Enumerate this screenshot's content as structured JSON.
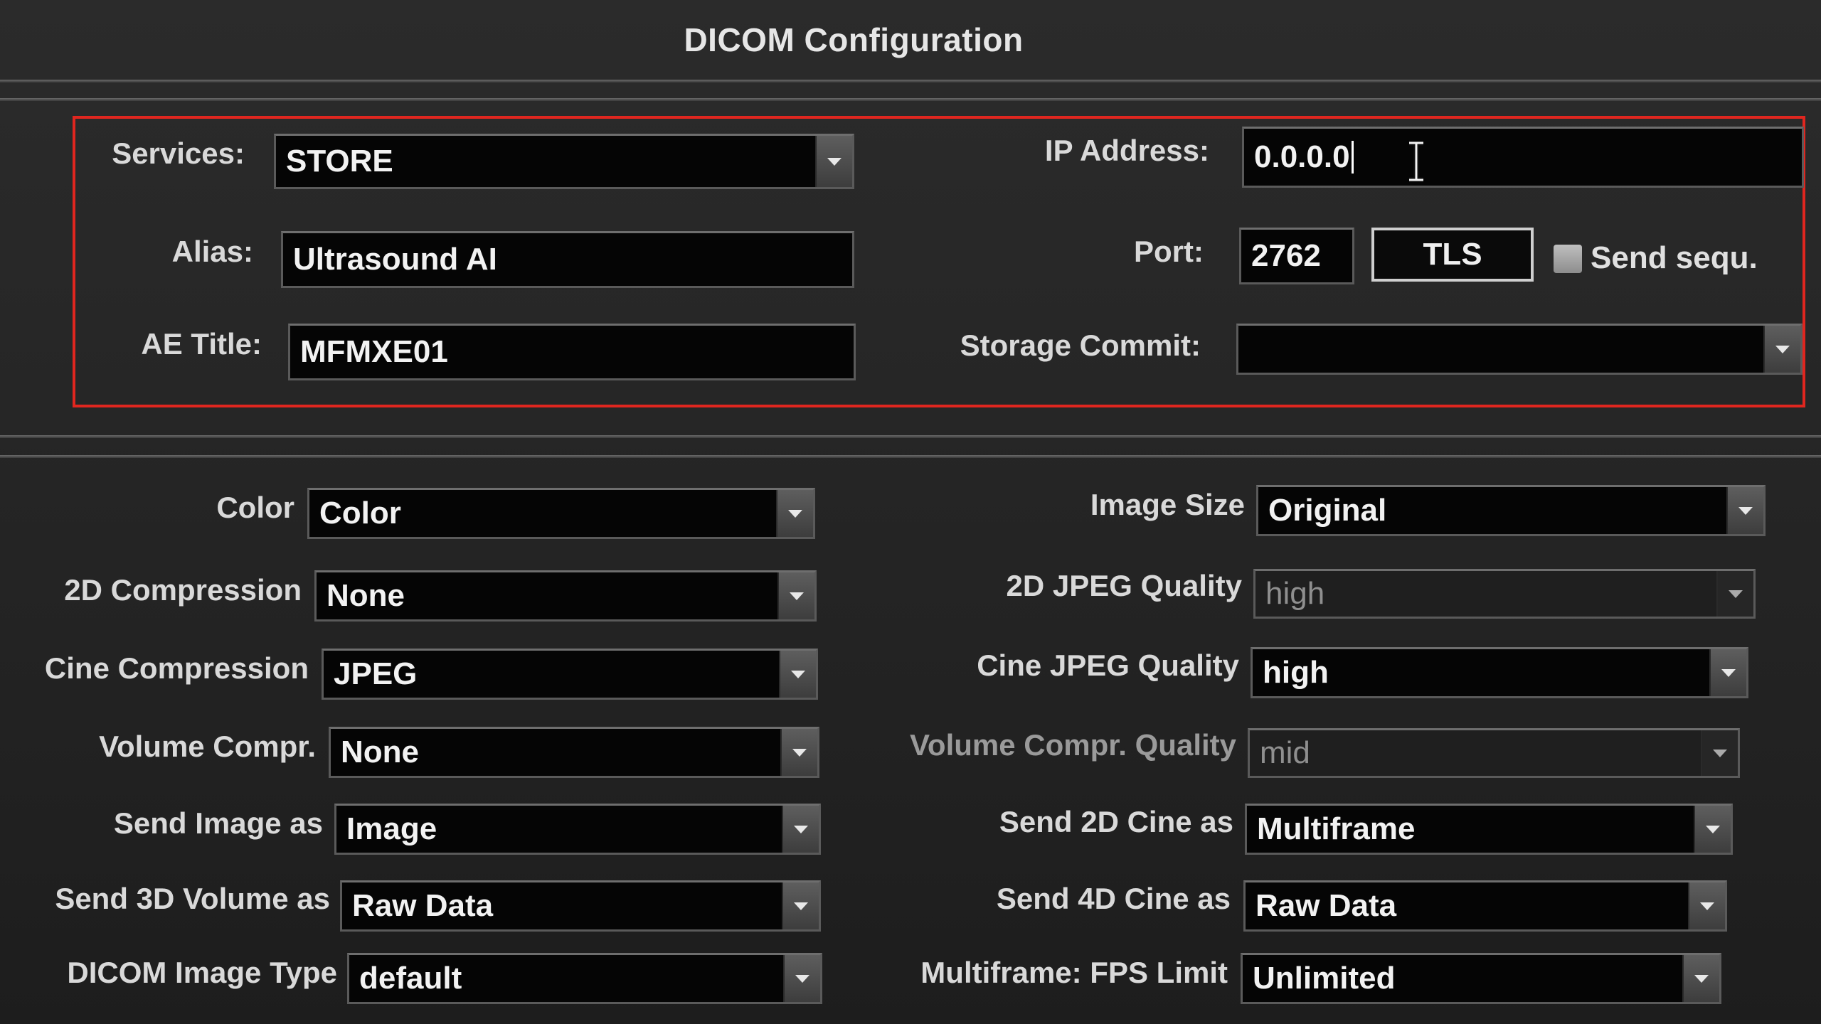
{
  "window": {
    "title": "DICOM Configuration"
  },
  "connection": {
    "services": {
      "label": "Services:",
      "value": "STORE"
    },
    "alias": {
      "label": "Alias:",
      "value": "Ultrasound AI"
    },
    "ae_title": {
      "label": "AE Title:",
      "value": "MFMXE01"
    },
    "ip_address": {
      "label": "IP Address:",
      "value": "0.0.0.0"
    },
    "port": {
      "label": "Port:",
      "value": "2762"
    },
    "tls_button": "TLS",
    "send_sequ": {
      "label": "Send sequ.",
      "checked": false
    },
    "storage_commit": {
      "label": "Storage Commit:",
      "value": ""
    }
  },
  "settings_left": [
    {
      "label": "Color",
      "value": "Color"
    },
    {
      "label": "2D Compression",
      "value": "None"
    },
    {
      "label": "Cine Compression",
      "value": "JPEG"
    },
    {
      "label": "Volume Compr.",
      "value": "None"
    },
    {
      "label": "Send Image as",
      "value": "Image"
    },
    {
      "label": "Send 3D Volume as",
      "value": "Raw Data"
    },
    {
      "label": "DICOM Image Type",
      "value": "default"
    }
  ],
  "settings_right": [
    {
      "label": "Image Size",
      "value": "Original",
      "enabled": true
    },
    {
      "label": "2D JPEG Quality",
      "value": "high",
      "enabled": false
    },
    {
      "label": "Cine JPEG Quality",
      "value": "high",
      "enabled": true
    },
    {
      "label": "Volume Compr. Quality",
      "value": "mid",
      "enabled": false
    },
    {
      "label": "Send 2D Cine as",
      "value": "Multiframe",
      "enabled": true
    },
    {
      "label": "Send 4D Cine as",
      "value": "Raw Data",
      "enabled": true
    },
    {
      "label": "Multiframe: FPS Limit",
      "value": "Unlimited",
      "enabled": true
    }
  ],
  "colors": {
    "highlight": "#e0261f",
    "field_bg": "#050505",
    "text": "#f2f2f2",
    "disabled_text": "#8f8f8f"
  }
}
